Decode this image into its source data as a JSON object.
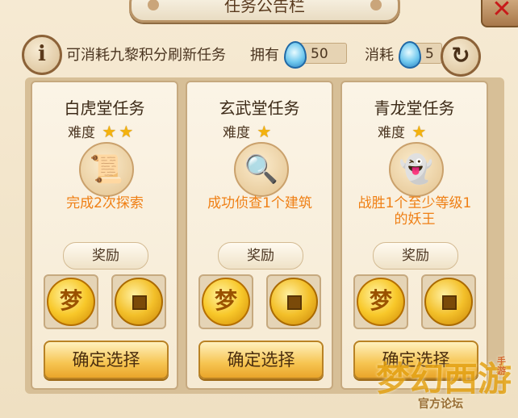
{
  "window": {
    "title": "任务公告栏"
  },
  "info": {
    "hint": "可消耗九黎积分刷新任务",
    "owned_label": "拥有",
    "owned_value": "50",
    "cost_label": "消耗",
    "cost_value": "5"
  },
  "cards": [
    {
      "title": "白虎堂任务",
      "difficulty_label": "难度",
      "stars": 2,
      "task_icon": "scroll-map-icon",
      "task": "完成2次探索",
      "reward_label": "奖励",
      "rewards": [
        "dream-coin-icon",
        "copper-coin-icon"
      ],
      "button": "确定选择"
    },
    {
      "title": "玄武堂任务",
      "difficulty_label": "难度",
      "stars": 1,
      "task_icon": "magnifier-icon",
      "task": "成功侦查1个建筑",
      "reward_label": "奖励",
      "rewards": [
        "dream-coin-icon",
        "copper-coin-icon"
      ],
      "button": "确定选择"
    },
    {
      "title": "青龙堂任务",
      "difficulty_label": "难度",
      "stars": 1,
      "task_icon": "ghost-icon",
      "task": "战胜1个至少等级1的妖王",
      "reward_label": "奖励",
      "rewards": [
        "dream-coin-icon",
        "copper-coin-icon"
      ],
      "button": "确定选择"
    }
  ],
  "watermark": {
    "logo": "梦幻西游",
    "sub": "官方论坛",
    "tag": "手游"
  },
  "colors": {
    "accent": "#ef7f14",
    "star": "#f4b20d",
    "button": "#f6c450"
  }
}
